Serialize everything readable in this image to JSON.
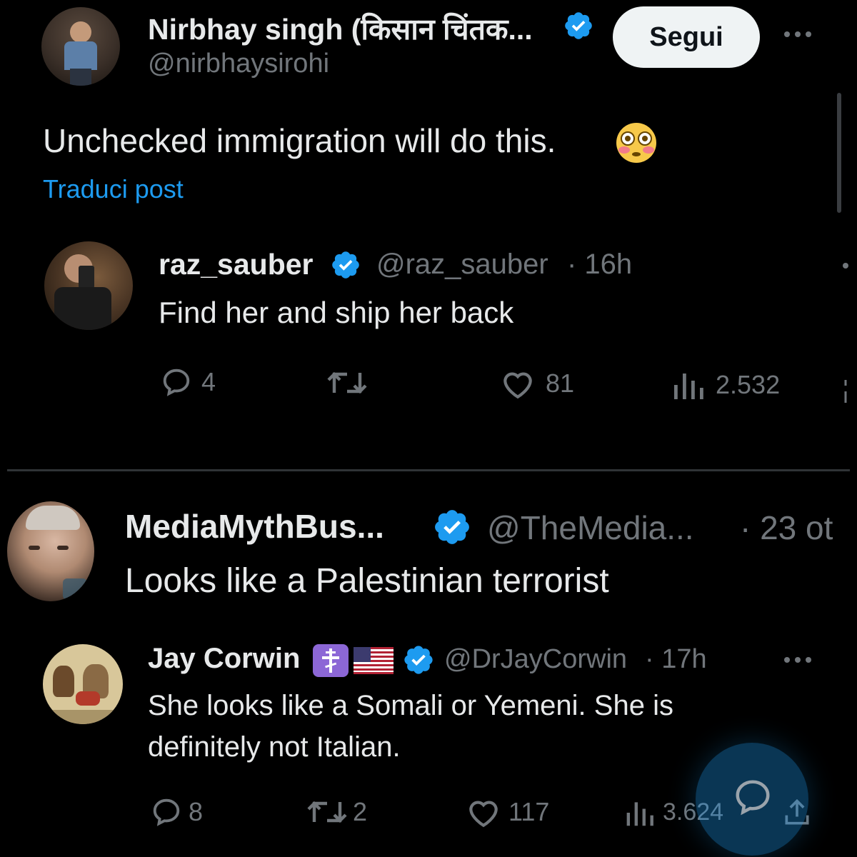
{
  "main_post": {
    "name": "Nirbhay singh (किसान चिंतक...",
    "handle": "@nirbhaysirohi",
    "follow_label": "Segui",
    "text": "Unchecked immigration will do this.",
    "translate_label": "Traduci post"
  },
  "reply1": {
    "name": "raz_sauber",
    "handle": "@raz_sauber",
    "time": "· 16h",
    "text": "Find her and ship her back",
    "replies": "4",
    "likes": "81",
    "views": "2.532"
  },
  "reply2": {
    "name": "MediaMythBus...",
    "handle": "@TheMedia...",
    "time": "· 23 ot",
    "text": "Looks like a Palestinian terrorist"
  },
  "reply3": {
    "name": "Jay Corwin",
    "handle": "@DrJayCorwin",
    "time": "· 17h",
    "text_line1": "She looks like a Somali or Yemeni. She is",
    "text_line2": "definitely not Italian.",
    "replies": "8",
    "reposts": "2",
    "likes": "117",
    "views": "3.624"
  },
  "colors": {
    "background": "#000000",
    "text": "#e7e9ea",
    "muted": "#71767b",
    "link": "#1d9bf0",
    "verified": "#1d9bf0",
    "fab": "#1d9bf0",
    "divider": "#2f3336"
  },
  "icons": [
    "verified-badge-icon",
    "more-options-icon",
    "flushed-face-emoji",
    "reply-icon",
    "repost-icon",
    "like-icon",
    "views-icon",
    "share-icon",
    "orthodox-cross-emoji",
    "us-flag-emoji",
    "compose-reply-icon"
  ]
}
